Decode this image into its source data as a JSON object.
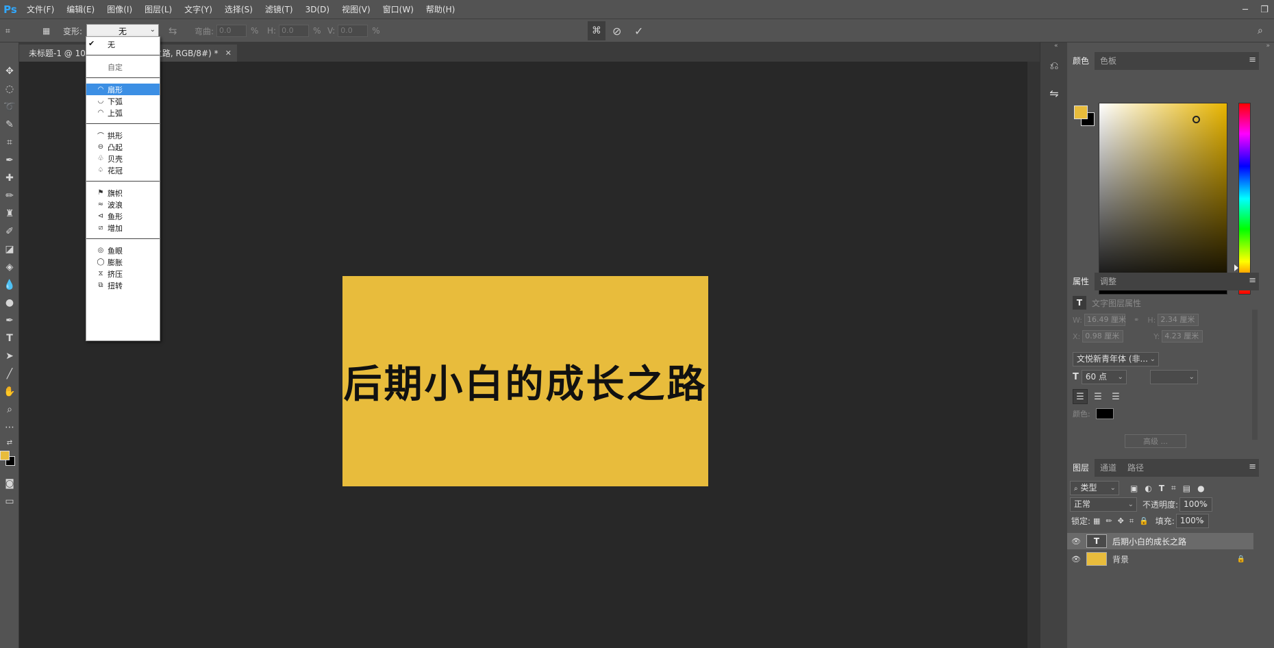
{
  "app": {
    "logo": "Ps",
    "menu": [
      "文件(F)",
      "编辑(E)",
      "图像(I)",
      "图层(L)",
      "文字(Y)",
      "选择(S)",
      "滤镜(T)",
      "3D(D)",
      "视图(V)",
      "窗口(W)",
      "帮助(H)"
    ]
  },
  "options_bar": {
    "warp_label": "变形:",
    "warp_value": "无",
    "bend_label": "弯曲:",
    "bend_value": "0.0",
    "h_label": "H:",
    "h_value": "0.0",
    "v_label": "V:",
    "v_value": "0.0",
    "percent": "%"
  },
  "document": {
    "tab_title": "未标题-1 @ 100% (后期小白的成长之路, RGB/8#) *",
    "tab_visible_left": "未标题-1 @ 10",
    "tab_visible_right": "之路, RGB/8#) *",
    "canvas_text": "后期小白的成长之路",
    "canvas_bg": "#e8bc3c"
  },
  "warp_menu": {
    "groups": [
      [
        {
          "label": "无",
          "icon": "check-icon",
          "checked": true
        }
      ],
      [
        {
          "label": "自定",
          "icon": "none"
        }
      ],
      [
        {
          "label": "扇形",
          "icon": "arc-icon",
          "selected": true
        },
        {
          "label": "下弧",
          "icon": "arc-lower-icon"
        },
        {
          "label": "上弧",
          "icon": "arc-upper-icon"
        }
      ],
      [
        {
          "label": "拱形",
          "icon": "arch-icon"
        },
        {
          "label": "凸起",
          "icon": "bulge-icon"
        },
        {
          "label": "贝壳",
          "icon": "shell-lower-icon"
        },
        {
          "label": "花冠",
          "icon": "shell-upper-icon"
        }
      ],
      [
        {
          "label": "旗帜",
          "icon": "flag-icon"
        },
        {
          "label": "波浪",
          "icon": "wave-icon"
        },
        {
          "label": "鱼形",
          "icon": "fish-icon"
        },
        {
          "label": "增加",
          "icon": "rise-icon"
        }
      ],
      [
        {
          "label": "鱼眼",
          "icon": "fisheye-icon"
        },
        {
          "label": "膨胀",
          "icon": "inflate-icon"
        },
        {
          "label": "挤压",
          "icon": "squeeze-icon"
        },
        {
          "label": "扭转",
          "icon": "twist-icon"
        }
      ]
    ]
  },
  "color_panel": {
    "tabs": [
      "颜色",
      "色板"
    ],
    "foreground": "#e8bc3c",
    "background": "#000000"
  },
  "properties_panel": {
    "tabs": [
      "属性",
      "调整"
    ],
    "section_title": "文字图层属性",
    "w_label": "W:",
    "w_value": "16.49 厘米",
    "h_label": "H:",
    "h_value": "2.34 厘米",
    "x_label": "X:",
    "x_value": "0.98 厘米",
    "y_label": "Y:",
    "y_value": "4.23 厘米",
    "font_family": "文悦新青年体 (非...",
    "font_size": "60 点",
    "color_label": "颜色:",
    "text_color": "#000000",
    "advanced_button": "高级 ..."
  },
  "layers_panel": {
    "tabs": [
      "图层",
      "通道",
      "路径"
    ],
    "filter_kind": "类型",
    "blend_mode": "正常",
    "opacity_label": "不透明度:",
    "opacity_value": "100%",
    "lock_label": "锁定:",
    "fill_label": "填充:",
    "fill_value": "100%",
    "layers": [
      {
        "name": "后期小白的成长之路",
        "type": "text",
        "selected": true
      },
      {
        "name": "背景",
        "type": "background",
        "color": "#e8bc3c",
        "locked": true
      }
    ]
  }
}
